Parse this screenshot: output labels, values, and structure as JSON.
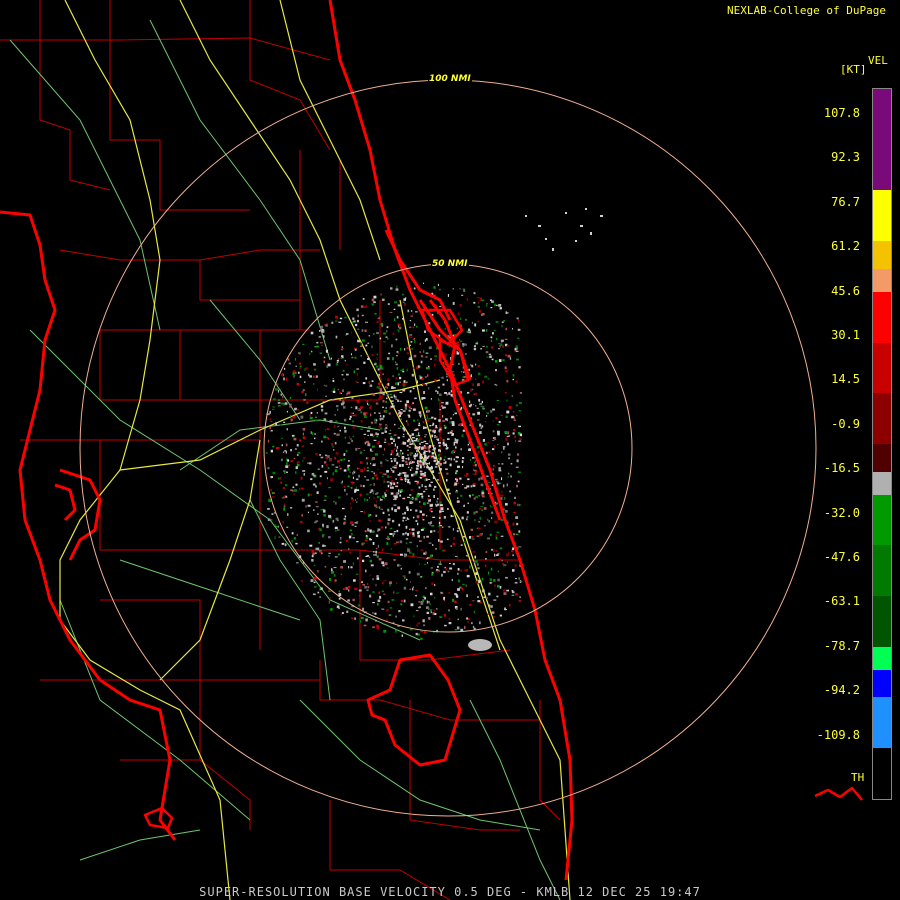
{
  "credit": "NEXLAB-College of DuPage",
  "footer": "SUPER-RESOLUTION BASE VELOCITY 0.5 DEG - KMLB 12 DEC 25 19:47",
  "range_rings": [
    {
      "label": "100 NMI",
      "distance_nmi": 100
    },
    {
      "label": "50 NMI",
      "distance_nmi": 50
    }
  ],
  "legend": {
    "product": "VEL",
    "unit": "[KT]",
    "ticks": [
      "107.8",
      "92.3",
      "76.7",
      "61.2",
      "45.6",
      "30.1",
      "14.5",
      "-0.9",
      "-16.5",
      "-32.0",
      "-47.6",
      "-63.1",
      "-78.7",
      "-94.2",
      "-109.8"
    ],
    "threshold_label": "TH",
    "segments": [
      {
        "color": "#7a0a7a",
        "span": 2
      },
      {
        "color": "#ffff00",
        "span": 1
      },
      {
        "color": "#f5c200",
        "span": 0.55
      },
      {
        "color": "#f39a66",
        "span": 0.45
      },
      {
        "color": "#ff0000",
        "span": 1
      },
      {
        "color": "#c80000",
        "span": 1
      },
      {
        "color": "#8c0000",
        "span": 1
      },
      {
        "color": "#500000",
        "span": 0.55
      },
      {
        "color": "#b0b0b0",
        "span": 0.45
      },
      {
        "color": "#009900",
        "span": 1
      },
      {
        "color": "#007a00",
        "span": 1
      },
      {
        "color": "#005500",
        "span": 1
      },
      {
        "color": "#00ff55",
        "span": 0.45
      },
      {
        "color": "#0000ff",
        "span": 0.55
      },
      {
        "color": "#1e90ff",
        "span": 1
      },
      {
        "color": "#000000",
        "span": 1
      }
    ]
  },
  "colors": {
    "county_lines": "#c00000",
    "coastline": "#ff0000",
    "highways": "#e8e840",
    "roads": "#6ec56e",
    "range_rings": "#f0b090"
  }
}
